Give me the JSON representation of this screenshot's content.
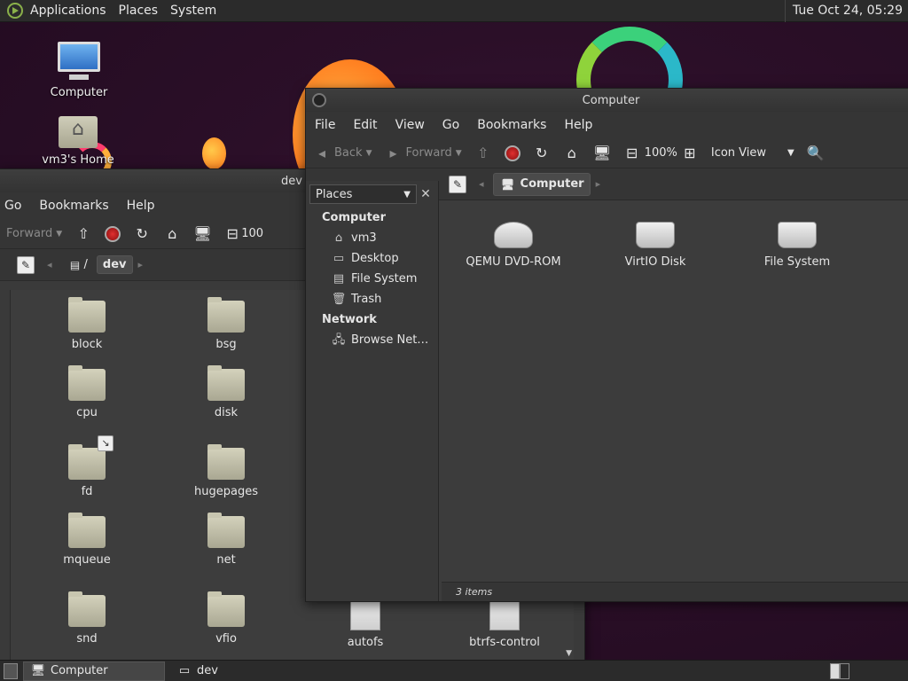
{
  "top_panel": {
    "menus": [
      "Applications",
      "Places",
      "System"
    ],
    "clock": "Tue Oct 24, 05:29"
  },
  "desktop_icons": {
    "computer": "Computer",
    "home": "vm3's Home"
  },
  "dev_window": {
    "title": "dev",
    "menus": [
      "Go",
      "Bookmarks",
      "Help"
    ],
    "toolbar": {
      "forward": "Forward",
      "zoom": "100"
    },
    "path": {
      "root": "/",
      "current": "dev"
    },
    "items": [
      "block",
      "bsg",
      "cpu",
      "disk",
      "fd",
      "hugepages",
      "mqueue",
      "net",
      "snd",
      "vfio",
      "autofs",
      "btrfs-control"
    ]
  },
  "computer_window": {
    "title": "Computer",
    "menus": [
      "File",
      "Edit",
      "View",
      "Go",
      "Bookmarks",
      "Help"
    ],
    "toolbar": {
      "back": "Back",
      "forward": "Forward",
      "zoom": "100%",
      "view_mode": "Icon View"
    },
    "location": "Computer",
    "sidebar": {
      "selector": "Places",
      "groups": [
        {
          "name": "Computer",
          "items": [
            "vm3",
            "Desktop",
            "File System",
            "Trash"
          ]
        },
        {
          "name": "Network",
          "items": [
            "Browse Net…"
          ]
        }
      ]
    },
    "drives": [
      "QEMU DVD-ROM",
      "VirtIO Disk",
      "File System"
    ],
    "status": "3 items"
  },
  "bottom_panel": {
    "tasks": [
      "Computer",
      "dev"
    ]
  }
}
